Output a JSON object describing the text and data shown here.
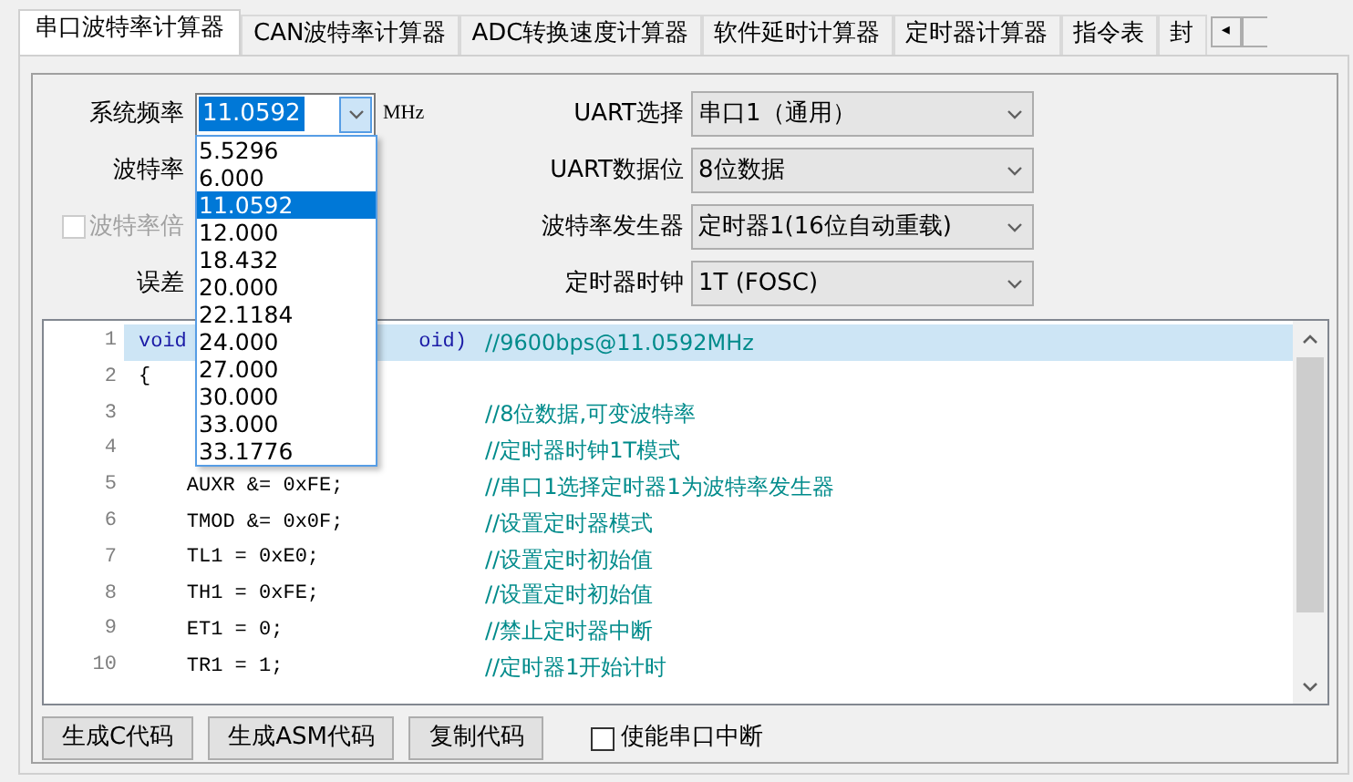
{
  "tabs": [
    {
      "label": "串口波特率计算器",
      "selected": true
    },
    {
      "label": "CAN波特率计算器",
      "selected": false
    },
    {
      "label": "ADC转换速度计算器",
      "selected": false
    },
    {
      "label": "软件延时计算器",
      "selected": false
    },
    {
      "label": "定时器计算器",
      "selected": false
    },
    {
      "label": "指令表",
      "selected": false
    },
    {
      "label": "封",
      "selected": false
    }
  ],
  "tab_scroll": {
    "left": "◂"
  },
  "left_form": [
    {
      "kind": "combo",
      "label": "系统频率",
      "value": "11.0592",
      "unit": "MHz"
    },
    {
      "kind": "label",
      "label": "波特率"
    },
    {
      "kind": "checkbox",
      "label": "波特率倍",
      "checked": false,
      "disabled": true
    },
    {
      "kind": "label",
      "label": "误差"
    }
  ],
  "right_form": [
    {
      "label": "UART选择",
      "value": "串口1（通用）"
    },
    {
      "label": "UART数据位",
      "value": "8位数据"
    },
    {
      "label": "波特率发生器",
      "value": "定时器1(16位自动重载)"
    },
    {
      "label": "定时器时钟",
      "value": "1T  (FOSC)"
    }
  ],
  "frequency_list": [
    {
      "text": "5.5296",
      "selected": false
    },
    {
      "text": "6.000",
      "selected": false
    },
    {
      "text": "11.0592",
      "selected": true
    },
    {
      "text": "12.000",
      "selected": false
    },
    {
      "text": "18.432",
      "selected": false
    },
    {
      "text": "20.000",
      "selected": false
    },
    {
      "text": "22.1184",
      "selected": false
    },
    {
      "text": "24.000",
      "selected": false
    },
    {
      "text": "27.000",
      "selected": false
    },
    {
      "text": "30.000",
      "selected": false
    },
    {
      "text": "33.000",
      "selected": false
    },
    {
      "text": "33.1776",
      "selected": false
    }
  ],
  "code_lines": [
    {
      "number": "1",
      "code": "void",
      "code_tail": "oid)",
      "comment": "//9600bps@11.0592MHz",
      "selected": true
    },
    {
      "number": "2",
      "code": "{",
      "selected": false
    },
    {
      "number": "3",
      "comment": "//8位数据,可变波特率",
      "selected": false
    },
    {
      "number": "4",
      "comment": "//定时器时钟1T模式",
      "selected": false
    },
    {
      "number": "5",
      "code": "    AUXR &= 0xFE;",
      "comment": "//串口1选择定时器1为波特率发生器",
      "selected": false
    },
    {
      "number": "6",
      "code": "    TMOD &= 0x0F;",
      "comment": "//设置定时器模式",
      "selected": false
    },
    {
      "number": "7",
      "code": "    TL1 = 0xE0;",
      "comment": "//设置定时初始值",
      "selected": false
    },
    {
      "number": "8",
      "code": "    TH1 = 0xFE;",
      "comment": "//设置定时初始值",
      "selected": false
    },
    {
      "number": "9",
      "code": "    ET1 = 0;",
      "comment": "//禁止定时器中断",
      "selected": false
    },
    {
      "number": "10",
      "code": "    TR1 = 1;",
      "comment": "//定时器1开始计时",
      "selected": false
    }
  ],
  "buttons": [
    "生成C代码",
    "生成ASM代码",
    "复制代码"
  ],
  "interrupt_checkbox": {
    "label": "使能串口中断",
    "checked": false
  }
}
